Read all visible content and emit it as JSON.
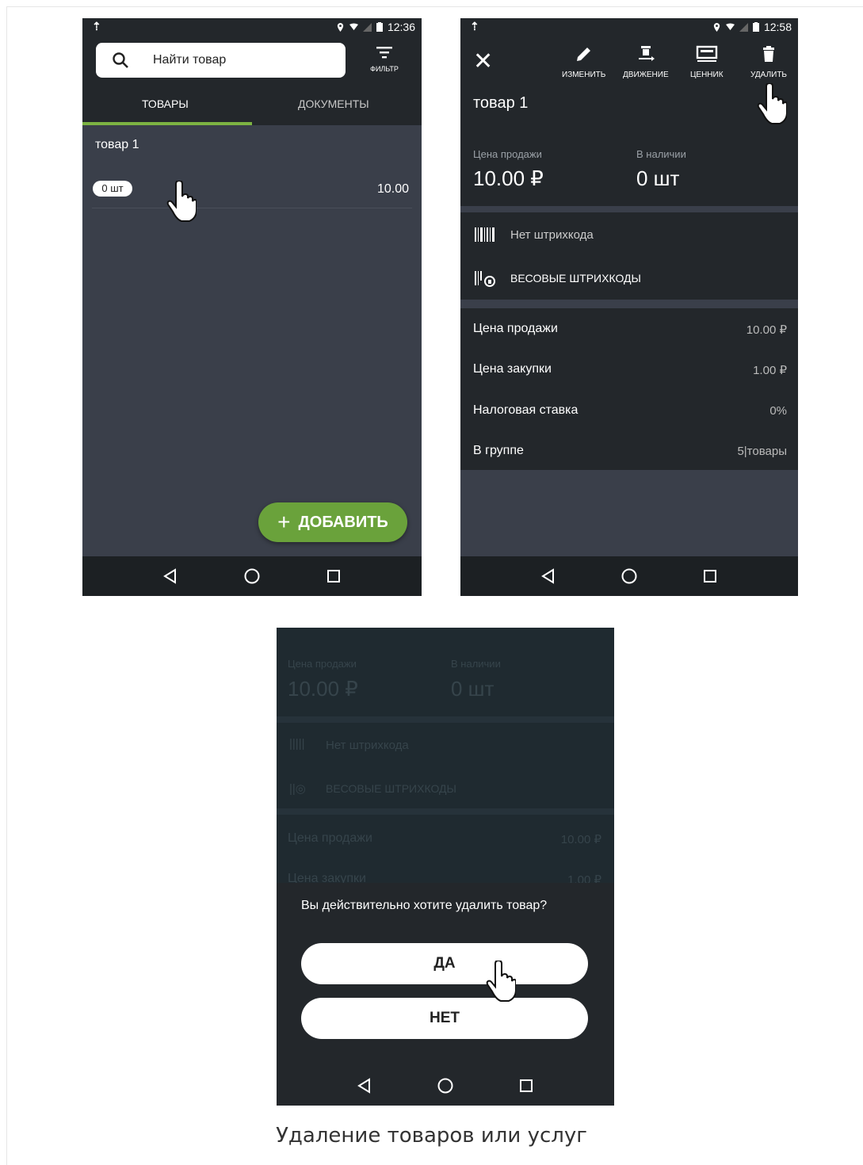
{
  "screen1": {
    "status": {
      "time": "12:36"
    },
    "search": {
      "placeholder": "Найти товар"
    },
    "filter_label": "ФИЛЬТР",
    "tabs": [
      {
        "label": "ТОВАРЫ",
        "active": true
      },
      {
        "label": "ДОКУМЕНТЫ",
        "active": false
      }
    ],
    "item": {
      "name": "товар 1",
      "qty": "0 шт",
      "price": "10.00"
    },
    "fab_label": "ДОБАВИТЬ"
  },
  "screen2": {
    "status": {
      "time": "12:58"
    },
    "toolbar": [
      {
        "label": "ИЗМЕНИТЬ",
        "icon": "pencil-icon"
      },
      {
        "label": "ДВИЖЕНИЕ",
        "icon": "movement-icon"
      },
      {
        "label": "ЦЕННИК",
        "icon": "price-tag-icon"
      },
      {
        "label": "УДАЛИТЬ",
        "icon": "trash-icon"
      }
    ],
    "title": "товар 1",
    "price_label": "Цена продажи",
    "price_value": "10.00 ₽",
    "stock_label": "В наличии",
    "stock_value": "0 шт",
    "barcode_none": "Нет штрихкода",
    "weight_barcodes": "ВЕСОВЫЕ ШТРИХКОДЫ",
    "details": [
      {
        "label": "Цена продажи",
        "value": "10.00 ₽"
      },
      {
        "label": "Цена закупки",
        "value": "1.00 ₽"
      },
      {
        "label": "Налоговая ставка",
        "value": "0%"
      },
      {
        "label": "В группе",
        "value": "5|товары"
      }
    ]
  },
  "screen3": {
    "bg": {
      "price_label": "Цена продажи",
      "price_value": "10.00 ₽",
      "stock_label": "В наличии",
      "stock_value": "0 шт",
      "barcode_none": "Нет штрихкода",
      "weight_barcodes": "ВЕСОВЫЕ ШТРИХКОДЫ",
      "row1_label": "Цена продажи",
      "row1_value": "10.00 ₽",
      "row2_label": "Цена закупки",
      "row2_value": "1.00 ₽"
    },
    "dialog": {
      "question": "Вы действительно хотите удалить товар?",
      "yes": "ДА",
      "no": "НЕТ"
    }
  },
  "caption": "Удаление товаров или услуг",
  "colors": {
    "accent_green": "#6aa23b",
    "dark_bg": "#23272b",
    "list_bg": "#3a3f4a"
  }
}
